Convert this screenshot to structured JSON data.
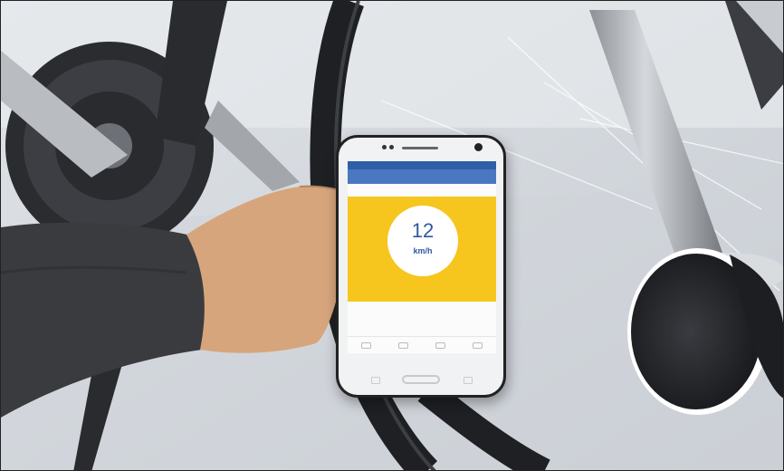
{
  "phone_app": {
    "status_text": "",
    "speed_value": "12",
    "speed_unit": "km/h"
  },
  "colors": {
    "panel_yellow": "#f6c61e",
    "header_blue": "#4a78c0",
    "speed_blue": "#2d5aa0",
    "sleeve_dark": "#3a3b3f",
    "skin": "#d7a57c"
  }
}
